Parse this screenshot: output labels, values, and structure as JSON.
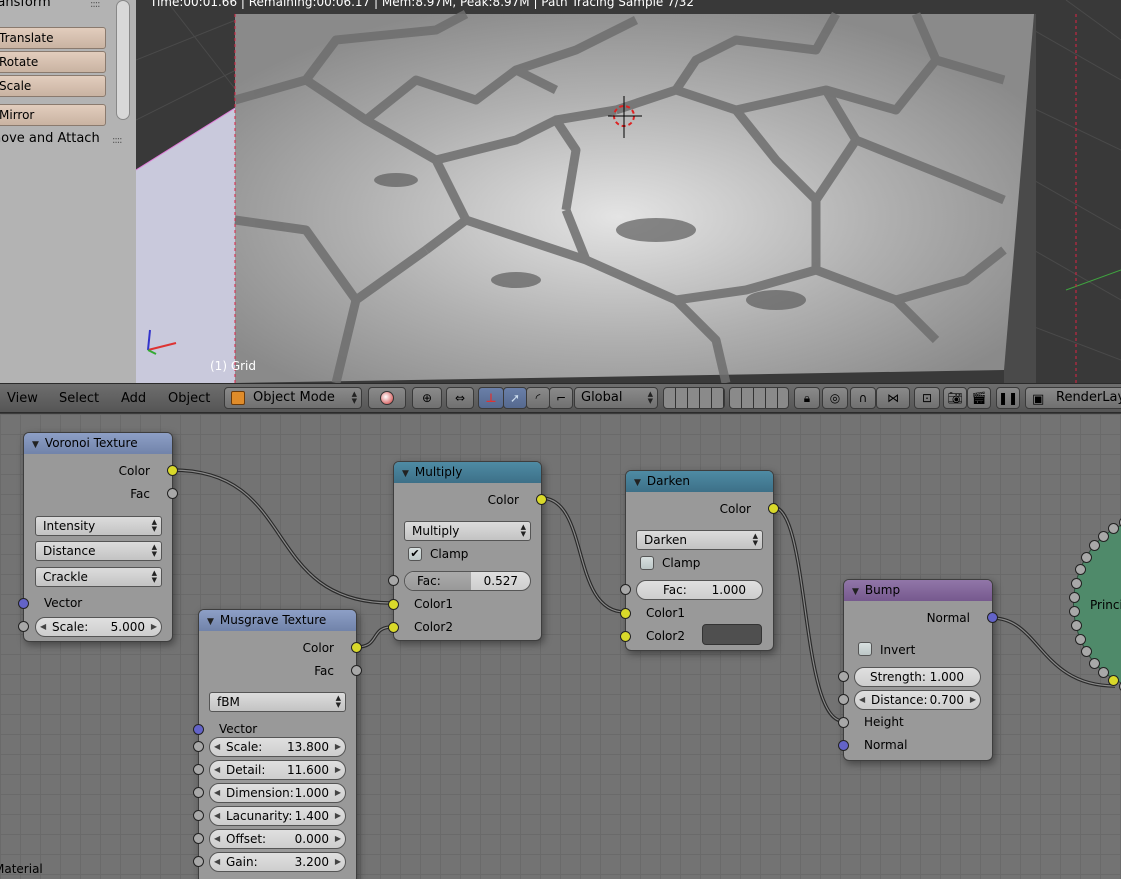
{
  "tool_shelf": {
    "title": "Transform",
    "buttons": [
      "Translate",
      "Rotate",
      "Scale",
      "Mirror"
    ],
    "section2": "Remove and Attach"
  },
  "viewport": {
    "status": "Time:00:01.66 | Remaining:00:06.17 | Mem:8.97M, Peak:8.97M | Path Tracing Sample 7/32",
    "object_label": "(1) Grid"
  },
  "header": {
    "menus": [
      "View",
      "Select",
      "Add",
      "Object"
    ],
    "mode": "Object Mode",
    "orientation": "Global",
    "render_layer": "RenderLayer"
  },
  "nodes": {
    "voronoi": {
      "title": "Voronoi Texture",
      "out_color": "Color",
      "out_fac": "Fac",
      "coloring": "Intensity",
      "metric": "Distance",
      "feature": "Crackle",
      "in_vector": "Vector",
      "scale_label": "Scale:",
      "scale_value": "5.000"
    },
    "musgrave": {
      "title": "Musgrave Texture",
      "out_color": "Color",
      "out_fac": "Fac",
      "type": "fBM",
      "in_vector": "Vector",
      "params": [
        {
          "label": "Scale:",
          "value": "13.800"
        },
        {
          "label": "Detail:",
          "value": "11.600"
        },
        {
          "label": "Dimension:",
          "value": "1.000"
        },
        {
          "label": "Lacunarity:",
          "value": "1.400"
        },
        {
          "label": "Offset:",
          "value": "0.000"
        },
        {
          "label": "Gain:",
          "value": "3.200"
        }
      ]
    },
    "multiply": {
      "title": "Multiply",
      "out_color": "Color",
      "blend": "Multiply",
      "clamp": "Clamp",
      "fac_label": "Fac:",
      "fac_value": "0.527",
      "fac_fraction": 0.527,
      "in1": "Color1",
      "in2": "Color2",
      "header_color": "#3d7b94"
    },
    "darken": {
      "title": "Darken",
      "out_color": "Color",
      "blend": "Darken",
      "clamp": "Clamp",
      "fac_label": "Fac:",
      "fac_value": "1.000",
      "in1": "Color1",
      "in2": "Color2",
      "header_color": "#3d7b94"
    },
    "bump": {
      "title": "Bump",
      "out_normal": "Normal",
      "invert": "Invert",
      "strength_label": "Strength:",
      "strength_value": "1.000",
      "distance_label": "Distance:",
      "distance_value": "0.700",
      "in_height": "Height",
      "in_normal": "Normal",
      "header_color": "#7b5c93"
    },
    "principled": {
      "title": "Principled BSDF",
      "header_color": "#4d8a6a"
    }
  },
  "status_bottom": "Material",
  "colors": {
    "socket_color": "#d9d92a",
    "socket_value": "#a8a8a8",
    "socket_vector": "#6363c8",
    "texture_header": "#7689b0"
  }
}
